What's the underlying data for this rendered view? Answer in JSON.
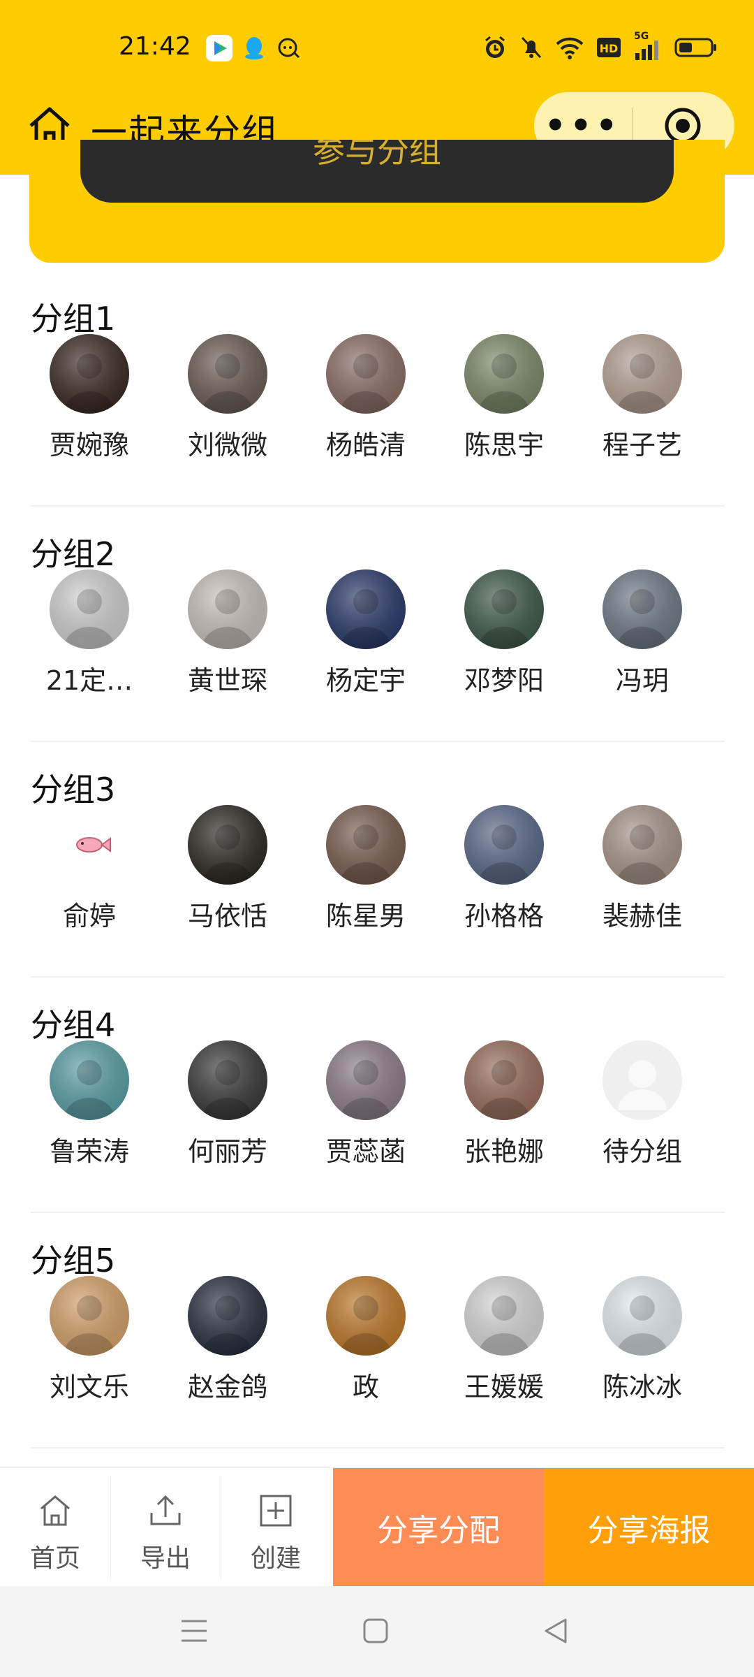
{
  "status_bar": {
    "time": "21:42",
    "network": "5G"
  },
  "header": {
    "title": "一起来分组",
    "more_label": "•••"
  },
  "card": {
    "button_label": "参与分组"
  },
  "groups": [
    {
      "title": "分组1",
      "members": [
        {
          "name": "贾婉豫",
          "color": "#3a2a22"
        },
        {
          "name": "刘微微",
          "color": "#6b5e55"
        },
        {
          "name": "杨皓清",
          "color": "#8c6e66"
        },
        {
          "name": "陈思宇",
          "color": "#7d8a6a"
        },
        {
          "name": "程子艺",
          "color": "#b7a295"
        }
      ]
    },
    {
      "title": "分组2",
      "members": [
        {
          "name": "21定…",
          "color": "#d0d0d0"
        },
        {
          "name": "黄世琛",
          "color": "#c9c2bd"
        },
        {
          "name": "杨定宇",
          "color": "#2a3a6a"
        },
        {
          "name": "邓梦阳",
          "color": "#3f5a4a"
        },
        {
          "name": "冯玥",
          "color": "#6f7b86"
        }
      ]
    },
    {
      "title": "分组3",
      "members": [
        {
          "name": "俞婷",
          "color": "#ffffff"
        },
        {
          "name": "马依恬",
          "color": "#2d2a24"
        },
        {
          "name": "陈星男",
          "color": "#7a5e50"
        },
        {
          "name": "孙格格",
          "color": "#5a6a8a"
        },
        {
          "name": "裴赫佳",
          "color": "#a8968a"
        }
      ]
    },
    {
      "title": "分组4",
      "members": [
        {
          "name": "鲁荣涛",
          "color": "#5aa0a8"
        },
        {
          "name": "何丽芳",
          "color": "#3a3a3a"
        },
        {
          "name": "贾蕊菡",
          "color": "#8d7e8a"
        },
        {
          "name": "张艳娜",
          "color": "#9a6e5e"
        },
        {
          "name": "待分组",
          "color": "#eeeeee"
        }
      ]
    },
    {
      "title": "分组5",
      "members": [
        {
          "name": "刘文乐",
          "color": "#d6a26a"
        },
        {
          "name": "赵金鸽",
          "color": "#2a3240"
        },
        {
          "name": "政",
          "color": "#c07a2a"
        },
        {
          "name": "王媛媛",
          "color": "#d8d8d8"
        },
        {
          "name": "陈冰冰",
          "color": "#e4eef4"
        }
      ]
    }
  ],
  "bottom_bar": {
    "tabs": [
      {
        "label": "首页",
        "icon": "home-icon"
      },
      {
        "label": "导出",
        "icon": "upload-icon"
      },
      {
        "label": "创建",
        "icon": "plus-square-icon"
      }
    ],
    "share_assign": "分享分配",
    "share_poster": "分享海报",
    "share_assign_color": "#ff8c55",
    "share_poster_color": "#ff9f0a"
  },
  "theme": {
    "accent": "#ffcc00"
  }
}
